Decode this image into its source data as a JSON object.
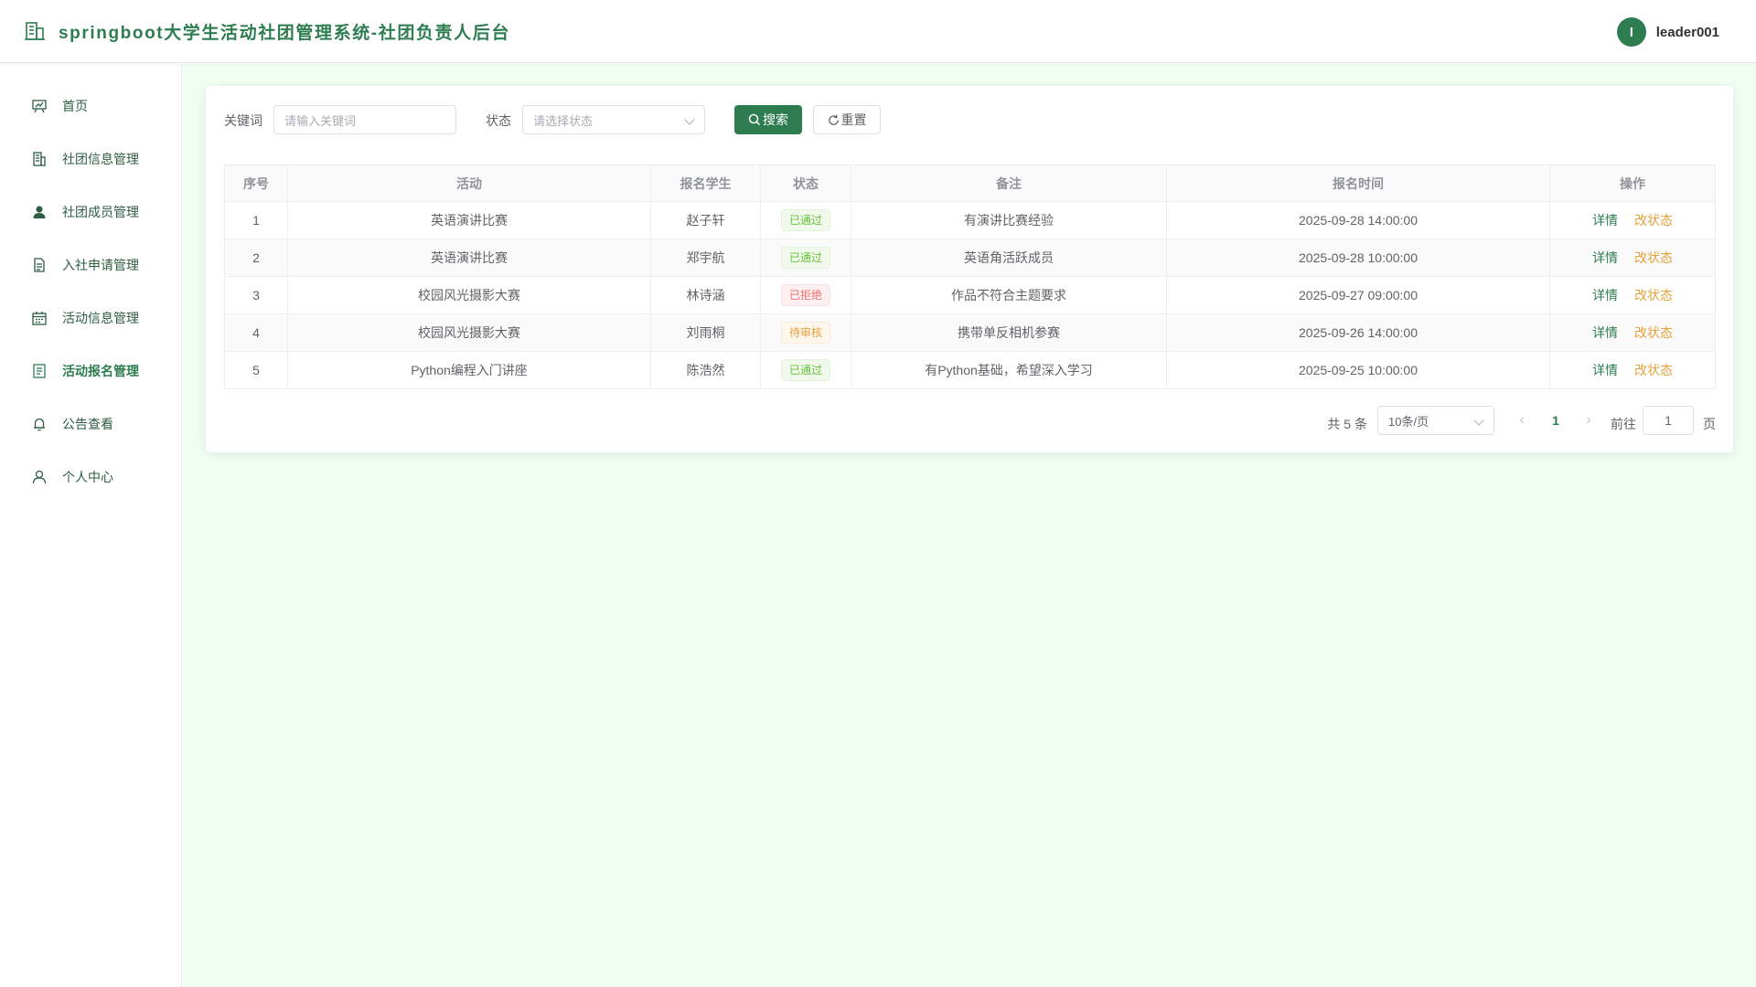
{
  "header": {
    "title": "springboot大学生活动社团管理系统-社团负责人后台",
    "avatar_letter": "l",
    "username": "leader001",
    "brand_color": "#2e7d50"
  },
  "sidebar": {
    "items": [
      {
        "label": "首页",
        "icon": "chart-board-icon",
        "active": false
      },
      {
        "label": "社团信息管理",
        "icon": "building-icon",
        "active": false
      },
      {
        "label": "社团成员管理",
        "icon": "user-filled-icon",
        "active": false
      },
      {
        "label": "入社申请管理",
        "icon": "document-icon",
        "active": false
      },
      {
        "label": "活动信息管理",
        "icon": "calendar-icon",
        "active": false
      },
      {
        "label": "活动报名管理",
        "icon": "tickets-icon",
        "active": true
      },
      {
        "label": "公告查看",
        "icon": "bell-icon",
        "active": false
      },
      {
        "label": "个人中心",
        "icon": "user-icon",
        "active": false
      }
    ]
  },
  "filters": {
    "keyword_label": "关键词",
    "keyword_placeholder": "请输入关键词",
    "status_label": "状态",
    "status_placeholder": "请选择状态",
    "search_button": "搜索",
    "reset_button": "重置"
  },
  "table": {
    "headers": [
      "序号",
      "活动",
      "报名学生",
      "状态",
      "备注",
      "报名时间",
      "操作"
    ],
    "rows": [
      {
        "index": "1",
        "activity": "英语演讲比赛",
        "student": "赵子轩",
        "status": "已通过",
        "status_type": "success",
        "note": "有演讲比赛经验",
        "time": "2025-09-28 14:00:00"
      },
      {
        "index": "2",
        "activity": "英语演讲比赛",
        "student": "郑宇航",
        "status": "已通过",
        "status_type": "success",
        "note": "英语角活跃成员",
        "time": "2025-09-28 10:00:00"
      },
      {
        "index": "3",
        "activity": "校园风光摄影大赛",
        "student": "林诗涵",
        "status": "已拒绝",
        "status_type": "danger",
        "note": "作品不符合主题要求",
        "time": "2025-09-27 09:00:00"
      },
      {
        "index": "4",
        "activity": "校园风光摄影大赛",
        "student": "刘雨桐",
        "status": "待审核",
        "status_type": "warning",
        "note": "携带单反相机参赛",
        "time": "2025-09-26 14:00:00"
      },
      {
        "index": "5",
        "activity": "Python编程入门讲座",
        "student": "陈浩然",
        "status": "已通过",
        "status_type": "success",
        "note": "有Python基础，希望深入学习",
        "time": "2025-09-25 10:00:00"
      }
    ],
    "action_detail": "详情",
    "action_change_status": "改状态"
  },
  "pagination": {
    "total_text": "共 5 条",
    "page_size": "10条/页",
    "current_page": "1",
    "goto_label": "前往",
    "goto_value": "1",
    "page_suffix": "页"
  }
}
